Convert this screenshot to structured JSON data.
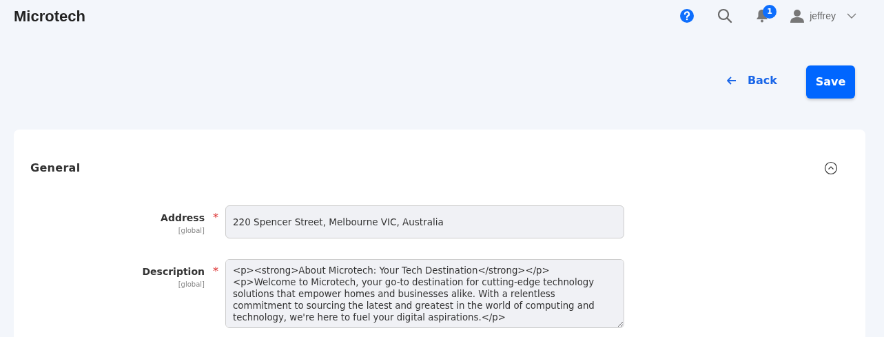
{
  "header": {
    "title": "Microtech",
    "notifications": "1",
    "user": "jeffrey"
  },
  "actions": {
    "back": "Back",
    "save": "Save"
  },
  "section": {
    "title": "General",
    "expanded": true,
    "fields": [
      {
        "kind": "input",
        "label": "Address",
        "required_mark": "*",
        "scope": "[global]",
        "value": "220 Spencer Street, Melbourne VIC, Australia"
      },
      {
        "kind": "textarea",
        "label": "Description",
        "required_mark": "*",
        "scope": "[global]",
        "value": "<p><strong>About Microtech: Your Tech Destination</strong></p>\n<p>Welcome to Microtech, your go-to destination for cutting-edge technology solutions that empower homes and businesses alike. With a relentless commitment to sourcing the latest and greatest in the world of computing and technology, we're here to fuel your digital aspirations.</p>"
      }
    ]
  }
}
